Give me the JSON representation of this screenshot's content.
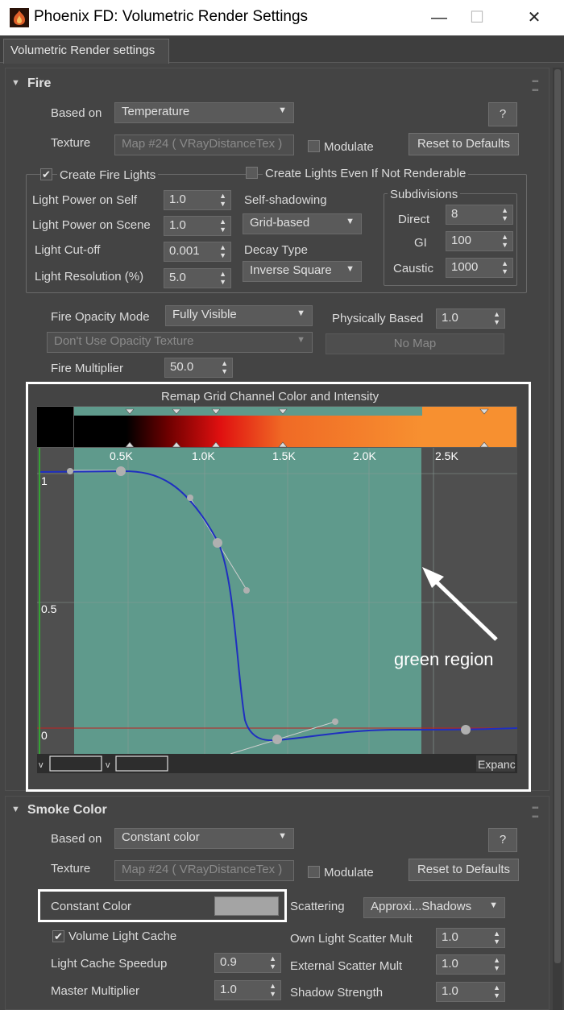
{
  "window": {
    "title": "Phoenix FD: Volumetric Render Settings",
    "minimize": "—",
    "maximize": "☐",
    "close": "✕"
  },
  "tab": {
    "label": "Volumetric Render settings"
  },
  "fire": {
    "header": "Fire",
    "based_on_label": "Based on",
    "based_on_value": "Temperature",
    "help": "?",
    "texture_label": "Texture",
    "texture_value": "Map #24  ( VRayDistanceTex )",
    "modulate_label": "Modulate",
    "reset_label": "Reset to Defaults",
    "create_fire_lights_label": "Create Fire Lights",
    "create_fire_lights_checked": "✔",
    "create_lights_not_renderable_label": "Create Lights Even If Not Renderable",
    "light_power_self_label": "Light Power on Self",
    "light_power_self_value": "1.0",
    "light_power_scene_label": "Light Power on Scene",
    "light_power_scene_value": "1.0",
    "light_cutoff_label": "Light Cut-off",
    "light_cutoff_value": "0.001",
    "light_resolution_label": "Light Resolution (%)",
    "light_resolution_value": "5.0",
    "self_shadowing_label": "Self-shadowing",
    "self_shadowing_value": "Grid-based",
    "decay_type_label": "Decay Type",
    "decay_type_value": "Inverse Square",
    "subdivisions_label": "Subdivisions",
    "direct_label": "Direct",
    "direct_value": "8",
    "gi_label": "GI",
    "gi_value": "100",
    "caustic_label": "Caustic",
    "caustic_value": "1000",
    "opacity_mode_label": "Fire Opacity Mode",
    "opacity_mode_value": "Fully Visible",
    "physically_based_label": "Physically Based",
    "physically_based_value": "1.0",
    "opacity_texture_value": "Don't Use Opacity Texture",
    "no_map_label": "No Map",
    "fire_multiplier_label": "Fire Multiplier",
    "fire_multiplier_value": "50.0"
  },
  "curve_editor": {
    "title": "Remap Grid Channel Color and Intensity",
    "x_ticks": [
      "0.5K",
      "1.0K",
      "1.5K",
      "2.0K",
      "2.5K"
    ],
    "y_ticks": [
      "1",
      "0.5",
      "0"
    ],
    "expand_label": "Expanc",
    "annotation": "green region",
    "colors": {
      "green_region": "#5f9a8c",
      "curve": "#1f2fc0",
      "outline": "#ffffff"
    }
  },
  "smoke": {
    "header": "Smoke Color",
    "based_on_label": "Based on",
    "based_on_value": "Constant color",
    "help": "?",
    "texture_label": "Texture",
    "texture_value": "Map #24  ( VRayDistanceTex )",
    "modulate_label": "Modulate",
    "reset_label": "Reset to Defaults",
    "constant_color_label": "Constant Color",
    "constant_color_swatch": "#a4a4a4",
    "scattering_label": "Scattering",
    "scattering_value": "Approxi...Shadows",
    "volume_light_cache_label": "Volume Light Cache",
    "volume_light_cache_checked": "✔",
    "own_light_scatter_label": "Own Light Scatter Mult",
    "own_light_scatter_value": "1.0",
    "light_cache_speedup_label": "Light Cache Speedup",
    "light_cache_speedup_value": "0.9",
    "external_scatter_label": "External Scatter Mult",
    "external_scatter_value": "1.0",
    "master_multiplier_label": "Master Multiplier",
    "master_multiplier_value": "1.0",
    "shadow_strength_label": "Shadow Strength",
    "shadow_strength_value": "1.0"
  }
}
